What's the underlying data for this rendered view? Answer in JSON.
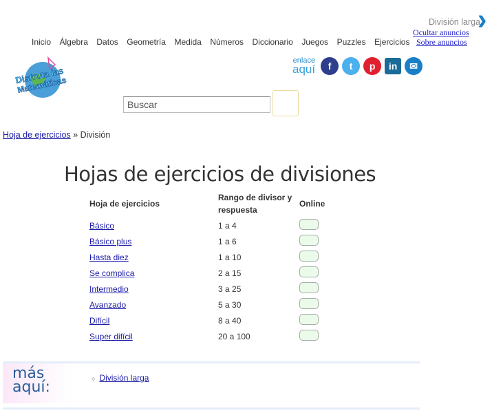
{
  "nav": [
    "Inicio",
    "Álgebra",
    "Datos",
    "Geometría",
    "Medida",
    "Números",
    "Diccionario",
    "Juegos",
    "Puzzles",
    "Ejercicios"
  ],
  "ad": {
    "title": "División larga",
    "hide": "Ocultar anuncios",
    "about": "Sobre anuncios"
  },
  "logo": "Disfruta las Matemáticas",
  "share": {
    "top": "enlace",
    "bottom": "aquí",
    "icons": [
      "facebook-icon",
      "twitter-icon",
      "pinterest-icon",
      "linkedin-icon",
      "email-icon"
    ]
  },
  "search": {
    "placeholder": "Buscar"
  },
  "breadcrumb": {
    "link": "Hoja de ejercicios",
    "sep": " » ",
    "current": "División"
  },
  "title": "Hojas de ejercicios de divisiones",
  "table": {
    "headers": [
      "Hoja de ejercicios",
      "Rango de divisor y respuesta",
      "Online"
    ],
    "rows": [
      [
        "Básico",
        "1 a 4"
      ],
      [
        "Básico plus",
        "1 a 6"
      ],
      [
        "Hasta diez",
        "1 a 10"
      ],
      [
        "Se complica",
        "2 a 15"
      ],
      [
        "Intermedio",
        "3 a 25"
      ],
      [
        "Avanzado",
        "5 a 30"
      ],
      [
        "Difícil",
        "8 a 40"
      ],
      [
        "Super difícil",
        "20 a 100"
      ]
    ]
  },
  "more": {
    "label1": "más",
    "label2": "aquí:",
    "links": [
      "División larga"
    ]
  }
}
